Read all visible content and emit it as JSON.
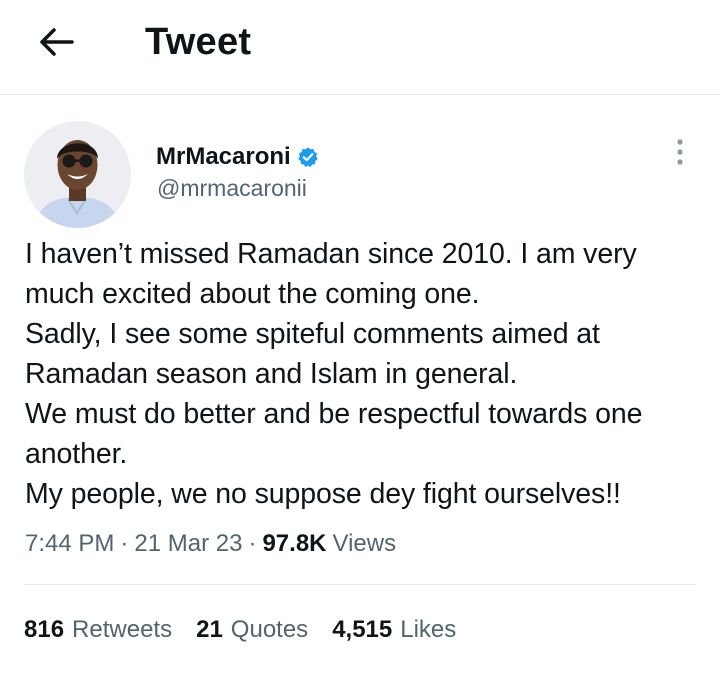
{
  "header": {
    "title": "Tweet",
    "back_icon": "arrow-left-icon"
  },
  "author": {
    "name": "MrMacaroni",
    "handle": "@mrmacaronii",
    "verified_icon": "verified-badge-icon",
    "verified_color": "#1d9bf0"
  },
  "tweet": {
    "text": "I haven’t missed Ramadan since 2010. I am very much excited about the coming one.\nSadly, I see some spiteful comments aimed at Ramadan season and Islam in general.\nWe must do better and be respectful towards one another.\nMy people, we no suppose dey fight ourselves!!",
    "time": "7:44 PM",
    "date": "21 Mar 23",
    "views_count": "97.8K",
    "views_label": "Views"
  },
  "stats": {
    "retweets_count": "816",
    "retweets_label": "Retweets",
    "quotes_count": "21",
    "quotes_label": "Quotes",
    "likes_count": "4,515",
    "likes_label": "Likes"
  },
  "colors": {
    "text": "#0f1419",
    "secondary": "#536471",
    "divider": "#e6e8ea"
  }
}
